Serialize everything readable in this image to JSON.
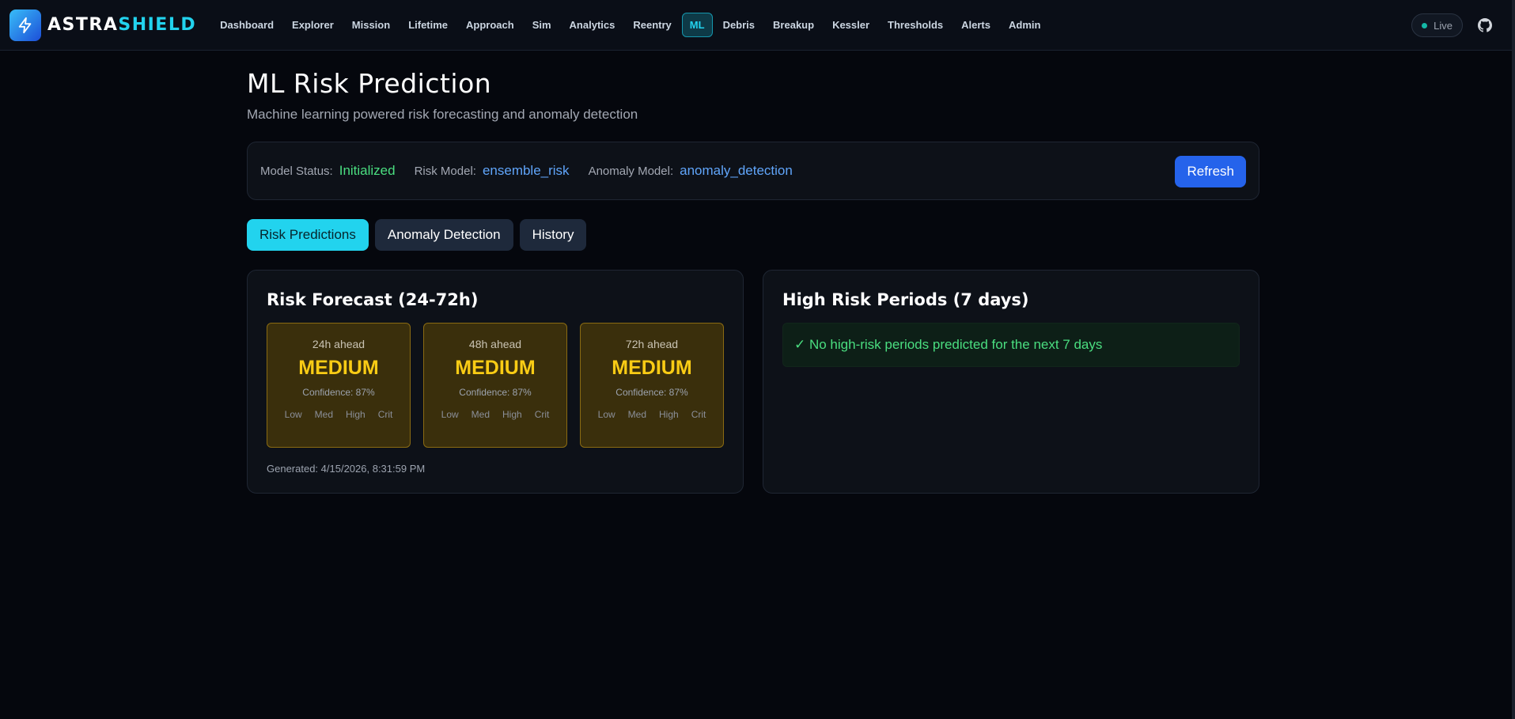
{
  "brand": {
    "name_part1": "ASTRA",
    "name_part2": "SHIELD"
  },
  "nav": {
    "items": [
      "Dashboard",
      "Explorer",
      "Mission",
      "Lifetime",
      "Approach",
      "Sim",
      "Analytics",
      "Reentry",
      "ML",
      "Debris",
      "Breakup",
      "Kessler",
      "Thresholds",
      "Alerts",
      "Admin"
    ],
    "active": "ML",
    "live_label": "Live"
  },
  "page": {
    "title": "ML Risk Prediction",
    "subtitle": "Machine learning powered risk forecasting and anomaly detection"
  },
  "status": {
    "model_status_label": "Model Status:",
    "model_status_value": "Initialized",
    "risk_model_label": "Risk Model:",
    "risk_model_value": "ensemble_risk",
    "anomaly_model_label": "Anomaly Model:",
    "anomaly_model_value": "anomaly_detection",
    "refresh_label": "Refresh"
  },
  "tabs": {
    "items": [
      "Risk Predictions",
      "Anomaly Detection",
      "History"
    ],
    "active": "Risk Predictions"
  },
  "forecast": {
    "title": "Risk Forecast (24-72h)",
    "cards": [
      {
        "horizon": "24h ahead",
        "level": "MEDIUM",
        "confidence": "Confidence: 87%"
      },
      {
        "horizon": "48h ahead",
        "level": "MEDIUM",
        "confidence": "Confidence: 87%"
      },
      {
        "horizon": "72h ahead",
        "level": "MEDIUM",
        "confidence": "Confidence: 87%"
      }
    ],
    "scale_labels": [
      "Low",
      "Med",
      "High",
      "Crit"
    ],
    "generated": "Generated: 4/15/2026, 8:31:59 PM"
  },
  "high_risk": {
    "title": "High Risk Periods (7 days)",
    "message": "✓ No high-risk periods predicted for the next 7 days"
  },
  "colors": {
    "accent": "#22d3ee",
    "primary_button": "#2563eb",
    "status_green": "#4ade80",
    "model_blue": "#60a5fa",
    "medium_risk": "#facc15"
  }
}
